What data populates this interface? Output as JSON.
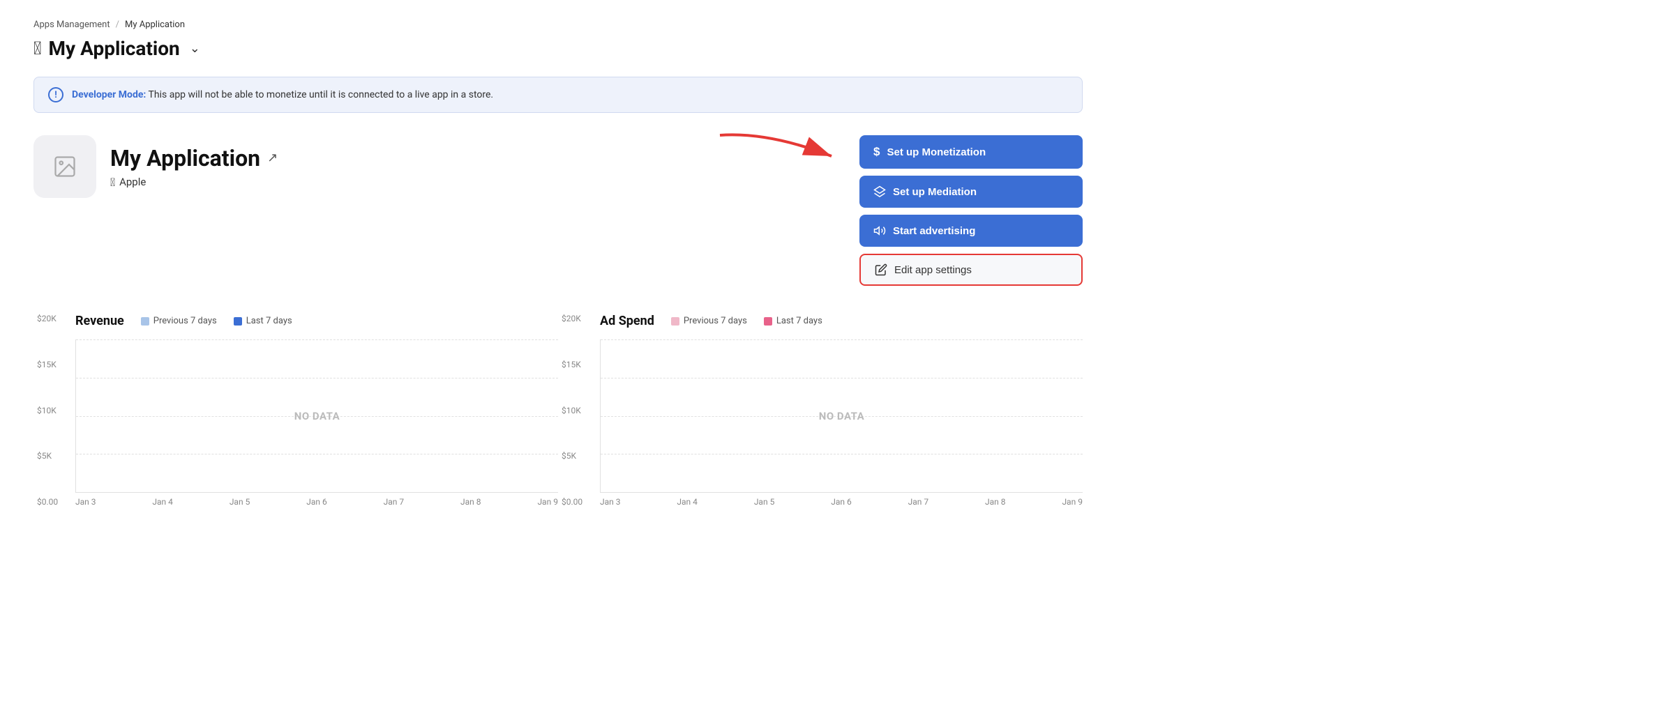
{
  "breadcrumb": {
    "parent": "Apps Management",
    "separator": "/",
    "current": "My Application"
  },
  "page_title": "My Application",
  "banner": {
    "label": "Developer Mode:",
    "message": " This app will not be able to monetize until it is connected to a live app in a store."
  },
  "app": {
    "name": "My Application",
    "platform": "Apple"
  },
  "buttons": {
    "monetization": "Set up Monetization",
    "mediation": "Set up Mediation",
    "advertising": "Start advertising",
    "edit_settings": "Edit app settings"
  },
  "charts": {
    "revenue": {
      "title": "Revenue",
      "legend": [
        {
          "label": "Previous 7 days",
          "color": "#a8c4e8"
        },
        {
          "label": "Last 7 days",
          "color": "#3b6ed4"
        }
      ],
      "y_labels": [
        "$20K",
        "$15K",
        "$10K",
        "$5K",
        "$0.00"
      ],
      "x_labels": [
        "Jan 3",
        "Jan 4",
        "Jan 5",
        "Jan 6",
        "Jan 7",
        "Jan 8",
        "Jan 9"
      ],
      "no_data": "NO DATA"
    },
    "ad_spend": {
      "title": "Ad Spend",
      "legend": [
        {
          "label": "Previous 7 days",
          "color": "#f0b8c8"
        },
        {
          "label": "Last 7 days",
          "color": "#e8628a"
        }
      ],
      "y_labels": [
        "$20K",
        "$15K",
        "$10K",
        "$5K",
        "$0.00"
      ],
      "x_labels": [
        "Jan 3",
        "Jan 4",
        "Jan 5",
        "Jan 6",
        "Jan 7",
        "Jan 8",
        "Jan 9"
      ],
      "no_data": "NO DATA"
    }
  }
}
